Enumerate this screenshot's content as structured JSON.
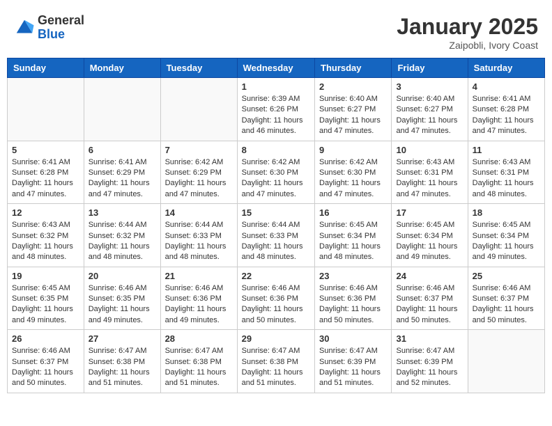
{
  "header": {
    "logo_general": "General",
    "logo_blue": "Blue",
    "month_title": "January 2025",
    "location": "Zaipobli, Ivory Coast"
  },
  "days_of_week": [
    "Sunday",
    "Monday",
    "Tuesday",
    "Wednesday",
    "Thursday",
    "Friday",
    "Saturday"
  ],
  "weeks": [
    [
      {
        "day": "",
        "info": ""
      },
      {
        "day": "",
        "info": ""
      },
      {
        "day": "",
        "info": ""
      },
      {
        "day": "1",
        "info": "Sunrise: 6:39 AM\nSunset: 6:26 PM\nDaylight: 11 hours and 46 minutes."
      },
      {
        "day": "2",
        "info": "Sunrise: 6:40 AM\nSunset: 6:27 PM\nDaylight: 11 hours and 47 minutes."
      },
      {
        "day": "3",
        "info": "Sunrise: 6:40 AM\nSunset: 6:27 PM\nDaylight: 11 hours and 47 minutes."
      },
      {
        "day": "4",
        "info": "Sunrise: 6:41 AM\nSunset: 6:28 PM\nDaylight: 11 hours and 47 minutes."
      }
    ],
    [
      {
        "day": "5",
        "info": "Sunrise: 6:41 AM\nSunset: 6:28 PM\nDaylight: 11 hours and 47 minutes."
      },
      {
        "day": "6",
        "info": "Sunrise: 6:41 AM\nSunset: 6:29 PM\nDaylight: 11 hours and 47 minutes."
      },
      {
        "day": "7",
        "info": "Sunrise: 6:42 AM\nSunset: 6:29 PM\nDaylight: 11 hours and 47 minutes."
      },
      {
        "day": "8",
        "info": "Sunrise: 6:42 AM\nSunset: 6:30 PM\nDaylight: 11 hours and 47 minutes."
      },
      {
        "day": "9",
        "info": "Sunrise: 6:42 AM\nSunset: 6:30 PM\nDaylight: 11 hours and 47 minutes."
      },
      {
        "day": "10",
        "info": "Sunrise: 6:43 AM\nSunset: 6:31 PM\nDaylight: 11 hours and 47 minutes."
      },
      {
        "day": "11",
        "info": "Sunrise: 6:43 AM\nSunset: 6:31 PM\nDaylight: 11 hours and 48 minutes."
      }
    ],
    [
      {
        "day": "12",
        "info": "Sunrise: 6:43 AM\nSunset: 6:32 PM\nDaylight: 11 hours and 48 minutes."
      },
      {
        "day": "13",
        "info": "Sunrise: 6:44 AM\nSunset: 6:32 PM\nDaylight: 11 hours and 48 minutes."
      },
      {
        "day": "14",
        "info": "Sunrise: 6:44 AM\nSunset: 6:33 PM\nDaylight: 11 hours and 48 minutes."
      },
      {
        "day": "15",
        "info": "Sunrise: 6:44 AM\nSunset: 6:33 PM\nDaylight: 11 hours and 48 minutes."
      },
      {
        "day": "16",
        "info": "Sunrise: 6:45 AM\nSunset: 6:34 PM\nDaylight: 11 hours and 48 minutes."
      },
      {
        "day": "17",
        "info": "Sunrise: 6:45 AM\nSunset: 6:34 PM\nDaylight: 11 hours and 49 minutes."
      },
      {
        "day": "18",
        "info": "Sunrise: 6:45 AM\nSunset: 6:34 PM\nDaylight: 11 hours and 49 minutes."
      }
    ],
    [
      {
        "day": "19",
        "info": "Sunrise: 6:45 AM\nSunset: 6:35 PM\nDaylight: 11 hours and 49 minutes."
      },
      {
        "day": "20",
        "info": "Sunrise: 6:46 AM\nSunset: 6:35 PM\nDaylight: 11 hours and 49 minutes."
      },
      {
        "day": "21",
        "info": "Sunrise: 6:46 AM\nSunset: 6:36 PM\nDaylight: 11 hours and 49 minutes."
      },
      {
        "day": "22",
        "info": "Sunrise: 6:46 AM\nSunset: 6:36 PM\nDaylight: 11 hours and 50 minutes."
      },
      {
        "day": "23",
        "info": "Sunrise: 6:46 AM\nSunset: 6:36 PM\nDaylight: 11 hours and 50 minutes."
      },
      {
        "day": "24",
        "info": "Sunrise: 6:46 AM\nSunset: 6:37 PM\nDaylight: 11 hours and 50 minutes."
      },
      {
        "day": "25",
        "info": "Sunrise: 6:46 AM\nSunset: 6:37 PM\nDaylight: 11 hours and 50 minutes."
      }
    ],
    [
      {
        "day": "26",
        "info": "Sunrise: 6:46 AM\nSunset: 6:37 PM\nDaylight: 11 hours and 50 minutes."
      },
      {
        "day": "27",
        "info": "Sunrise: 6:47 AM\nSunset: 6:38 PM\nDaylight: 11 hours and 51 minutes."
      },
      {
        "day": "28",
        "info": "Sunrise: 6:47 AM\nSunset: 6:38 PM\nDaylight: 11 hours and 51 minutes."
      },
      {
        "day": "29",
        "info": "Sunrise: 6:47 AM\nSunset: 6:38 PM\nDaylight: 11 hours and 51 minutes."
      },
      {
        "day": "30",
        "info": "Sunrise: 6:47 AM\nSunset: 6:39 PM\nDaylight: 11 hours and 51 minutes."
      },
      {
        "day": "31",
        "info": "Sunrise: 6:47 AM\nSunset: 6:39 PM\nDaylight: 11 hours and 52 minutes."
      },
      {
        "day": "",
        "info": ""
      }
    ]
  ]
}
